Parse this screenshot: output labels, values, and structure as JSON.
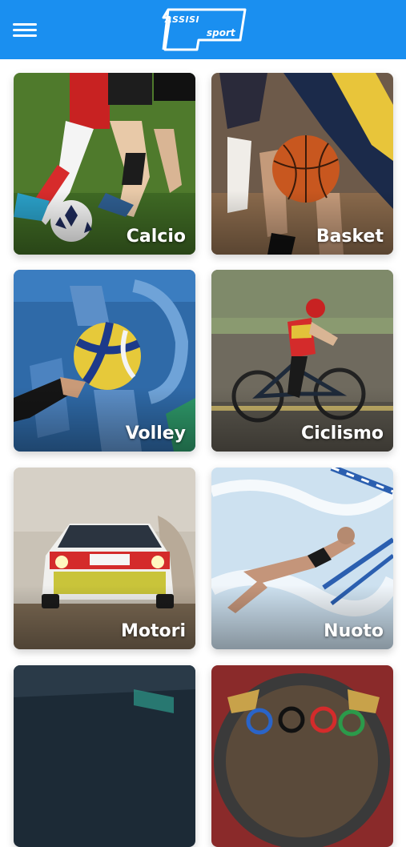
{
  "header": {
    "logo_line1": "ASSISI",
    "logo_line2": "sport",
    "brand_color": "#1a8ff0",
    "menu_icon": "hamburger-icon"
  },
  "sports": [
    {
      "label": "Calcio"
    },
    {
      "label": "Basket"
    },
    {
      "label": "Volley"
    },
    {
      "label": "Ciclismo"
    },
    {
      "label": "Motori"
    },
    {
      "label": "Nuoto"
    },
    {
      "label": ""
    },
    {
      "label": ""
    }
  ]
}
